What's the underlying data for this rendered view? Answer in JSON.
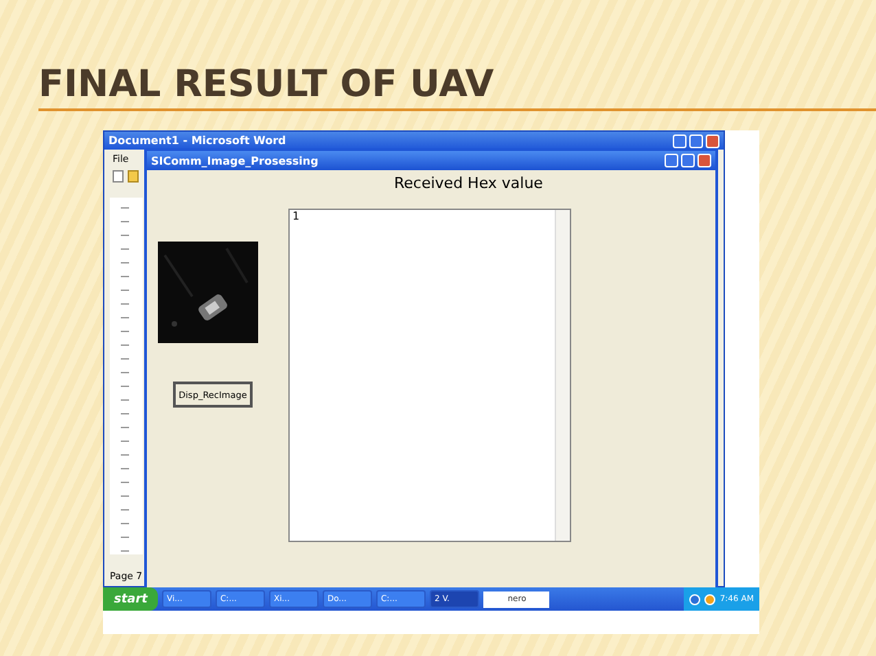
{
  "slide": {
    "title": "FINAL RESULT OF UAV"
  },
  "back_window": {
    "title": "Document1 - Microsoft Word",
    "menu": [
      "File"
    ],
    "status": "Page 7"
  },
  "dialog": {
    "title": "SIComm_Image_Prosessing",
    "heading": "Received Hex value",
    "button": "Disp_RecImage",
    "text_area": {
      "value": "1"
    }
  },
  "taskbar": {
    "start": "start",
    "tasks": [
      {
        "label": "Vi...",
        "selected": false
      },
      {
        "label": "C:...",
        "selected": false
      },
      {
        "label": "Xi...",
        "selected": false
      },
      {
        "label": "Do...",
        "selected": false
      },
      {
        "label": "C:...",
        "selected": false
      },
      {
        "label": "2 V.",
        "selected": true
      }
    ],
    "badge": "nero",
    "time": "7:46 AM"
  }
}
